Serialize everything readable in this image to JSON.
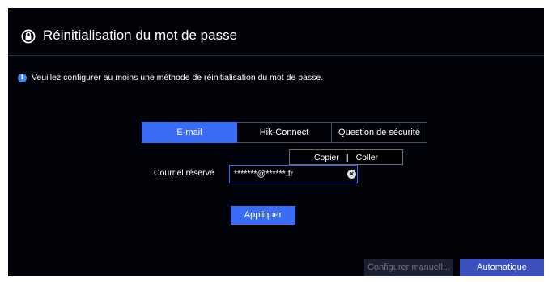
{
  "dialog": {
    "title": "Réinitialisation du mot de passe",
    "title_icon": "lock-reset-icon",
    "info": {
      "icon": "info-icon",
      "icon_glyph": "i",
      "text": "Veuillez configurer au moins une méthode de réinitialisation du mot de passe."
    },
    "tabs": [
      {
        "label": "E-mail",
        "active": true
      },
      {
        "label": "Hik-Connect",
        "active": false
      },
      {
        "label": "Question de sécurité",
        "active": false
      }
    ],
    "clipboard": {
      "copy_label": "Copier",
      "separator": "|",
      "paste_label": "Coller"
    },
    "email_field": {
      "label": "Courriel réservé",
      "value": "*******@******.fr",
      "clear_icon": "clear-icon"
    },
    "apply_label": "Appliquer",
    "footer": {
      "manual_label": "Configurer manuell...",
      "auto_label": "Automatique"
    }
  },
  "colors": {
    "background": "#020309",
    "accent": "#3b6cf5",
    "auto_button": "#3b4fbd",
    "disabled_button": "#1d2030",
    "info": "#3f87ff"
  }
}
